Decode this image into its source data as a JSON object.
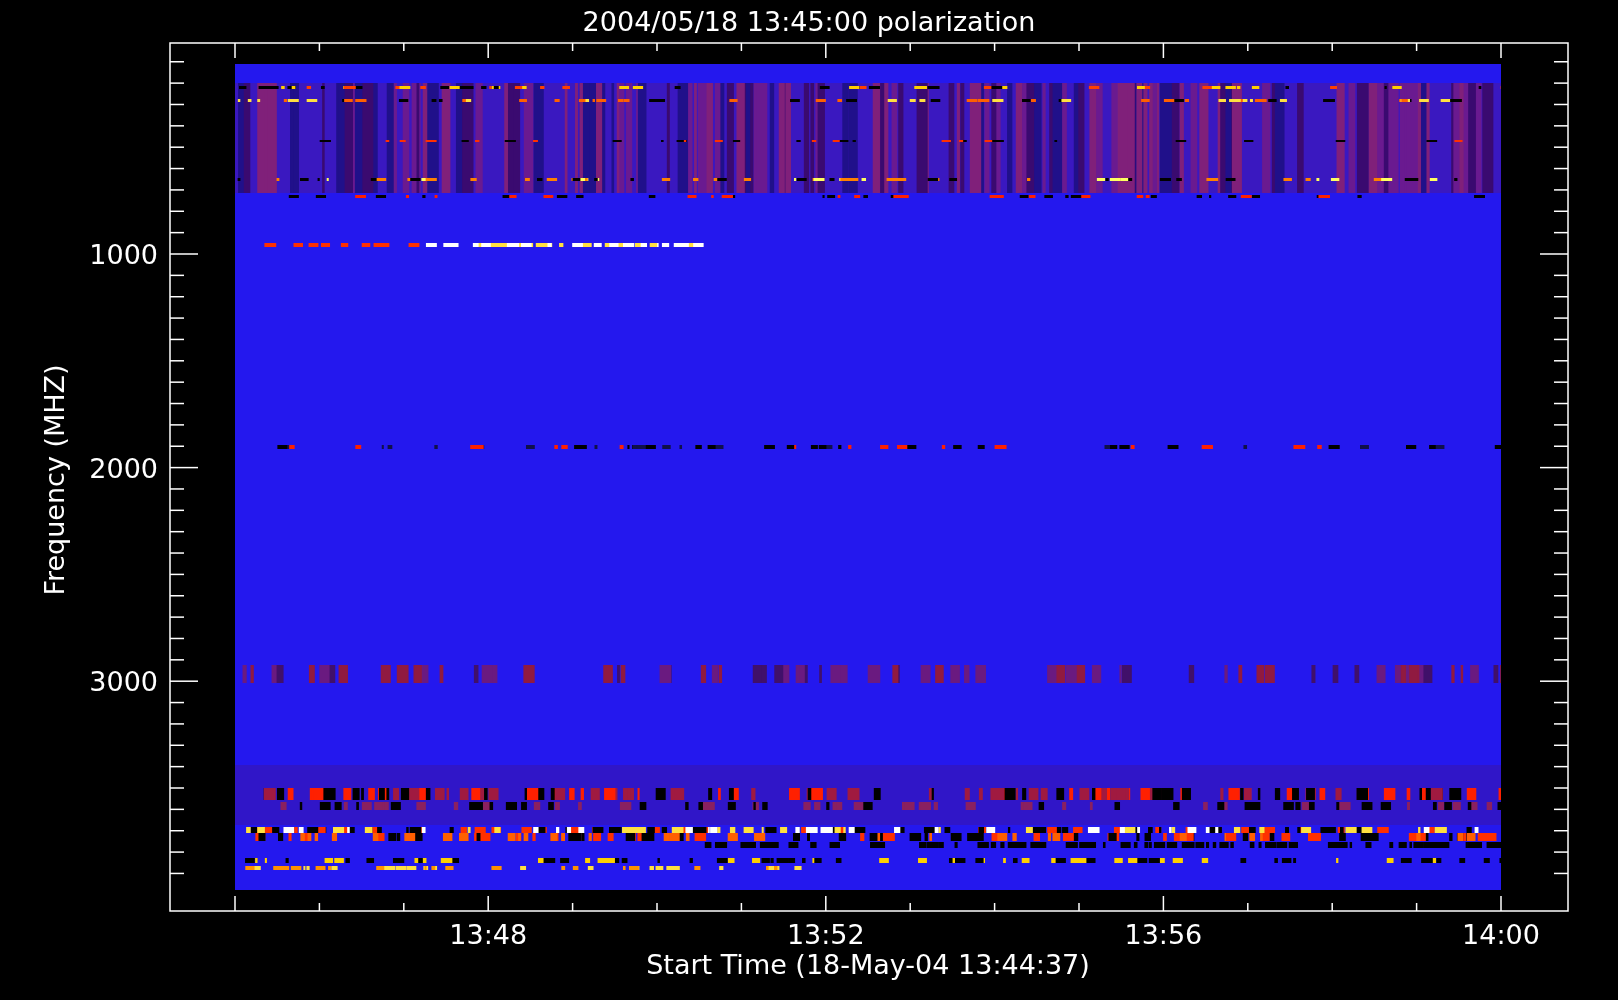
{
  "title": "2004/05/18 13:45:00 polarization",
  "x_axis": {
    "label": "Start Time (18-May-04 13:44:37)",
    "ticks": [
      "13:48",
      "13:52",
      "13:56",
      "14:00"
    ]
  },
  "y_axis": {
    "label": "Frequency (MHZ)",
    "ticks": [
      "1000",
      "2000",
      "3000"
    ]
  }
}
